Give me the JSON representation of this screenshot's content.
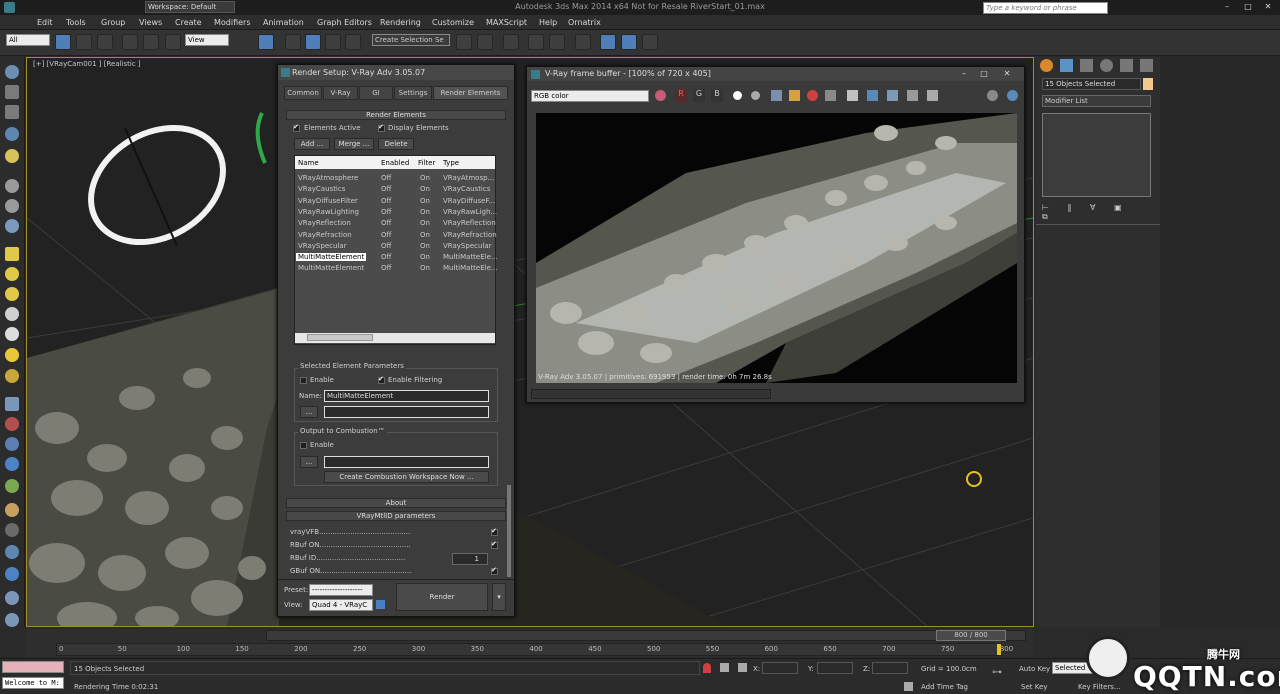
{
  "app": {
    "title": "Autodesk 3ds Max  2014 x64    Not for Resale    RiverStart_01.max",
    "workspace": "Workspace: Default",
    "search_placeholder": "Type a keyword or phrase"
  },
  "menu": [
    "Edit",
    "Tools",
    "Group",
    "Views",
    "Create",
    "Modifiers",
    "Animation",
    "Graph Editors",
    "Rendering",
    "Customize",
    "MAXScript",
    "Help",
    "Ornatrix"
  ],
  "toolbar": {
    "filter": "All",
    "refcoord": "View",
    "selection_set": "Create Selection Se"
  },
  "viewport": {
    "label": "[+] [VRayCam001 ] [Realistic ]"
  },
  "command_panel": {
    "selection_name": "15 Objects Selected",
    "modifier_list": "Modifier List"
  },
  "render_setup": {
    "title": "Render Setup: V-Ray Adv 3.05.07",
    "tabs": [
      "Common",
      "V-Ray",
      "GI",
      "Settings",
      "Render Elements"
    ],
    "rollout": "Render Elements",
    "elements_active": "Elements Active",
    "display_elements": "Display Elements",
    "add": "Add ...",
    "merge": "Merge ...",
    "delete": "Delete",
    "columns": [
      "Name",
      "Enabled",
      "Filter",
      "Type"
    ],
    "rows": [
      [
        "VRayAtmosphere",
        "Off",
        "On",
        "VRayAtmosp..."
      ],
      [
        "VRayCaustics",
        "Off",
        "On",
        "VRayCaustics"
      ],
      [
        "VRayDiffuseFilter",
        "Off",
        "On",
        "VRayDiffuseF..."
      ],
      [
        "VRayRawLighting",
        "Off",
        "On",
        "VRayRawLigh..."
      ],
      [
        "VRayReflection",
        "Off",
        "On",
        "VRayReflection"
      ],
      [
        "VRayRefraction",
        "Off",
        "On",
        "VRayRefraction"
      ],
      [
        "VRaySpecular",
        "Off",
        "On",
        "VRaySpecular"
      ],
      [
        "MultiMatteElement",
        "Off",
        "On",
        "MultiMatteEle..."
      ],
      [
        "MultiMatteElement",
        "Off",
        "On",
        "MultiMatteEle..."
      ]
    ],
    "sel_params": "Selected Element Parameters",
    "enable": "Enable",
    "enable_filtering": "Enable Filtering",
    "name_label": "Name:",
    "name_value": "MultiMatteElement",
    "browse": "...",
    "combustion": "Output to Combustion™",
    "combustion_btn": "Create Combustion Workspace Now ...",
    "about": "About",
    "mtlid": "VRayMtlID parameters",
    "params": [
      "vrayVFB.........................................",
      "RBuf ON.........................................",
      "RBuf ID........................................",
      "GBuf ON........................................."
    ],
    "rbuf_id": "1",
    "preset_label": "Preset:",
    "preset_value": "--------------------",
    "view_label": "View:",
    "view_value": "Quad 4 - VRayC",
    "render": "Render"
  },
  "vfb": {
    "title": "V-Ray frame buffer - [100% of 720 x 405]",
    "channel": "RGB color",
    "status": "V-Ray Adv 3.05.07  | primitives: 691953  | render time: 0h  7m 26.8s"
  },
  "timeline": {
    "frame": "800 / 800",
    "ticks": [
      "0",
      "50",
      "100",
      "150",
      "200",
      "250",
      "300",
      "350",
      "400",
      "450",
      "500",
      "550",
      "600",
      "650",
      "700",
      "750",
      "800"
    ]
  },
  "status": {
    "selected": "15 Objects Selected",
    "rendering_time": "Rendering Time  0:02:31",
    "welcome": "Welcome to M:",
    "x": "X:",
    "y": "Y:",
    "z": "Z:",
    "grid": "Grid = 100.0cm",
    "add_time_tag": "Add Time Tag",
    "auto_key": "Auto Key",
    "selected_btn": "Selected",
    "set_key": "Set Key",
    "key_filters": "Key Filters..."
  },
  "watermark": {
    "brand": "腾牛网",
    "site": "QQTN.com"
  }
}
